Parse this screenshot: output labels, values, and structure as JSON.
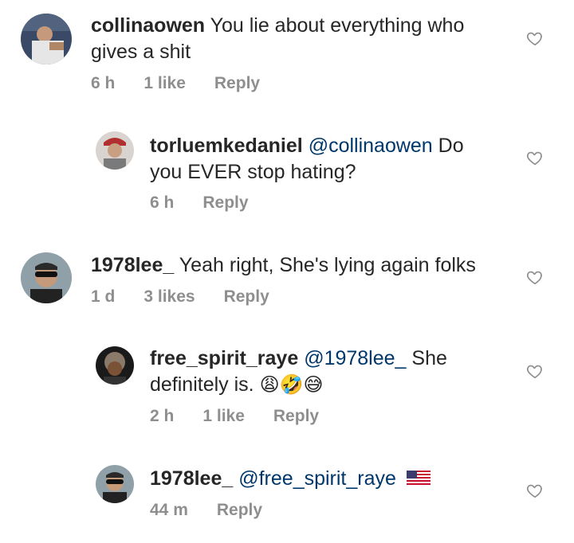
{
  "colors": {
    "text": "#262626",
    "muted": "#8e8e8e",
    "mention": "#00376b"
  },
  "comments": [
    {
      "username": "collinaowen",
      "mention": "",
      "text_line1": "You lie about everything who",
      "text_line2": "gives a shit",
      "time": "6 h",
      "likes": "1 like",
      "reply": "Reply"
    },
    {
      "username": "torluemkedaniel",
      "mention": "@collinaowen",
      "text_line1": "Do",
      "text_line2": "you EVER stop hating?",
      "time": "6 h",
      "likes": "",
      "reply": "Reply"
    },
    {
      "username": "1978lee_",
      "mention": "",
      "text_line1": "Yeah right, She's lying again folks",
      "text_line2": "",
      "time": "1 d",
      "likes": "3 likes",
      "reply": "Reply"
    },
    {
      "username": "free_spirit_raye",
      "mention": "@1978lee_",
      "text_line1": "She",
      "text_line2": "definitely is.",
      "emojis": "😩🤣😅",
      "time": "2 h",
      "likes": "1 like",
      "reply": "Reply"
    },
    {
      "username": "1978lee_",
      "mention": "@free_spirit_raye",
      "text_line1": "",
      "text_line2": "",
      "time": "44 m",
      "likes": "",
      "reply": "Reply",
      "flag_icon": "us-flag-icon"
    }
  ]
}
